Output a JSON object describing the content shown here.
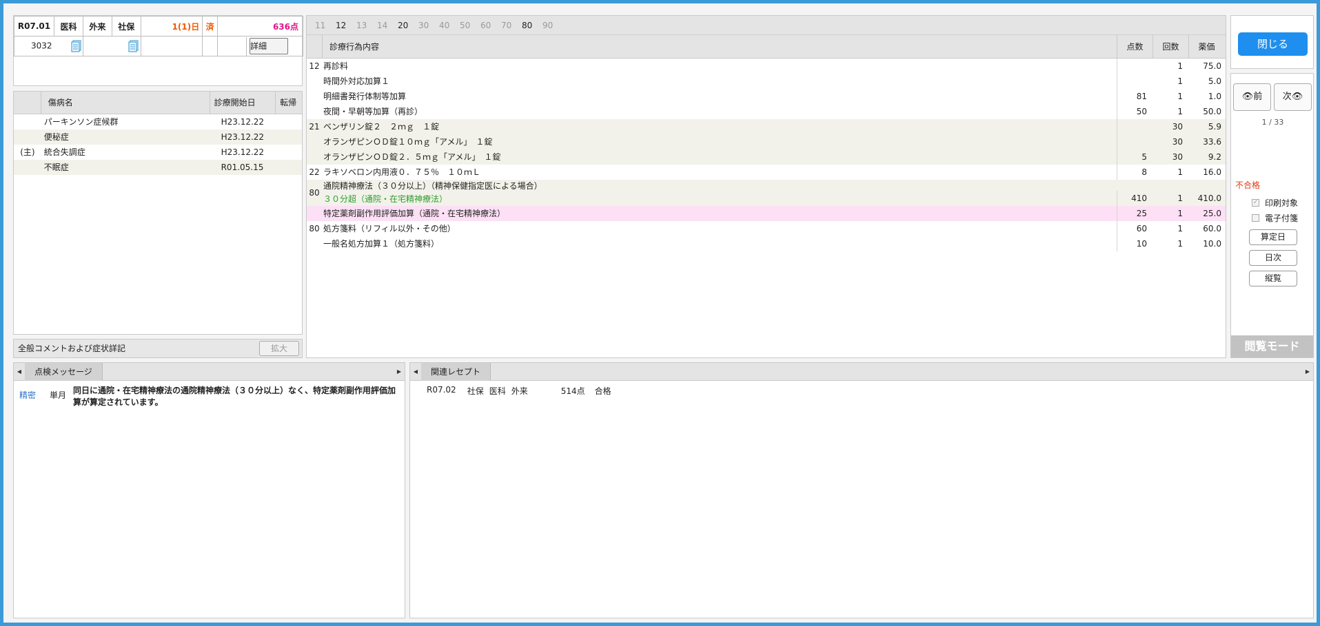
{
  "header": {
    "month": "R07.01",
    "type1": "医科",
    "type2": "外来",
    "insurance": "社保",
    "days": "1(1)日",
    "done": "済",
    "points": "636点",
    "patient_no": "3032",
    "detail_label": "詳細"
  },
  "disease": {
    "columns": [
      "傷病名",
      "診療開始日",
      "転帰"
    ],
    "rows": [
      {
        "main": "",
        "name": "パーキンソン症候群",
        "date": "H23.12.22",
        "outcome": ""
      },
      {
        "main": "",
        "name": "便秘症",
        "date": "H23.12.22",
        "outcome": ""
      },
      {
        "main": "(主)",
        "name": "統合失調症",
        "date": "H23.12.22",
        "outcome": ""
      },
      {
        "main": "",
        "name": "不眠症",
        "date": "R01.05.15",
        "outcome": ""
      }
    ]
  },
  "comment": {
    "label": "全般コメントおよび症状詳記",
    "enlarge": "拡大"
  },
  "treatment": {
    "tabs": [
      {
        "label": "11",
        "on": false
      },
      {
        "label": "12",
        "on": true
      },
      {
        "label": "13",
        "on": false
      },
      {
        "label": "14",
        "on": false
      },
      {
        "label": "20",
        "on": true
      },
      {
        "label": "30",
        "on": false
      },
      {
        "label": "40",
        "on": false
      },
      {
        "label": "50",
        "on": false
      },
      {
        "label": "60",
        "on": false
      },
      {
        "label": "70",
        "on": false
      },
      {
        "label": "80",
        "on": true
      },
      {
        "label": "90",
        "on": false
      }
    ],
    "columns": {
      "name": "診療行為内容",
      "points": "点数",
      "count": "回数",
      "price": "薬価"
    },
    "rows": [
      {
        "code": "12",
        "name": "再診料",
        "sub": "",
        "points": "",
        "count": "1",
        "price": "75.0",
        "bg": "w"
      },
      {
        "code": "",
        "name": "時間外対応加算１",
        "sub": "",
        "points": "",
        "count": "1",
        "price": "5.0",
        "bg": "w"
      },
      {
        "code": "",
        "name": "明細書発行体制等加算",
        "sub": "",
        "points": "81",
        "count": "1",
        "price": "1.0",
        "bg": "w"
      },
      {
        "code": "",
        "name": "夜間・早朝等加算（再診）",
        "sub": "",
        "points": "50",
        "count": "1",
        "price": "50.0",
        "bg": "w"
      },
      {
        "code": "21",
        "name": "ベンザリン錠２　２ｍｇ　１錠",
        "sub": "",
        "points": "",
        "count": "30",
        "price": "5.9",
        "bg": "a"
      },
      {
        "code": "",
        "name": "オランザピンＯＤ錠１０ｍｇ「アメル」　１錠",
        "sub": "",
        "points": "",
        "count": "30",
        "price": "33.6",
        "bg": "a"
      },
      {
        "code": "",
        "name": "オランザピンＯＤ錠２．５ｍｇ「アメル」　１錠",
        "sub": "",
        "points": "5",
        "count": "30",
        "price": "9.2",
        "bg": "a"
      },
      {
        "code": "22",
        "name": "ラキソベロン内用液０．７５％　１０ｍＬ",
        "sub": "",
        "points": "8",
        "count": "1",
        "price": "16.0",
        "bg": "w"
      },
      {
        "code": "80",
        "name": "通院精神療法（３０分以上）（精神保健指定医による場合）",
        "sub": "３０分超（通院・在宅精神療法）",
        "points": "410",
        "count": "1",
        "price": "410.0",
        "bg": "a"
      },
      {
        "code": "",
        "name": "特定薬剤副作用評価加算（通院・在宅精神療法）",
        "sub": "",
        "points": "25",
        "count": "1",
        "price": "25.0",
        "bg": "p"
      },
      {
        "code": "80",
        "name": "処方箋料（リフィル以外・その他）",
        "sub": "",
        "points": "60",
        "count": "1",
        "price": "60.0",
        "bg": "w"
      },
      {
        "code": "",
        "name": "一般名処方加算１（処方箋料）",
        "sub": "",
        "points": "10",
        "count": "1",
        "price": "10.0",
        "bg": "w"
      }
    ]
  },
  "right": {
    "close": "閉じる",
    "prev": "前",
    "next": "次",
    "page": "1 / 33",
    "status": "不合格",
    "print_target": "印刷対象",
    "e_attach": "電子付箋",
    "btn_calc_date": "算定日",
    "btn_daily": "日次",
    "btn_vertical": "縦覧",
    "mode": "閲覧モード"
  },
  "check": {
    "tab": "点検メッセージ",
    "level": "精密",
    "period": "単月",
    "text": "同日に通院・在宅精神療法の通院精神療法（３０分以上）なく、特定薬剤副作用評価加算が算定されています。"
  },
  "related": {
    "tab": "関連レセプト",
    "month": "R07.02",
    "insurance": "社保",
    "type1": "医科",
    "type2": "外来",
    "points": "514点",
    "result": "合格"
  },
  "colors": {
    "accent": "#1e8fee",
    "frame": "#3b9ad8",
    "pink_row": "#fde0f5",
    "alt_row": "#f2f2ea",
    "fail": "#e23a17",
    "points": "#e0158a",
    "days": "#f05a00"
  }
}
